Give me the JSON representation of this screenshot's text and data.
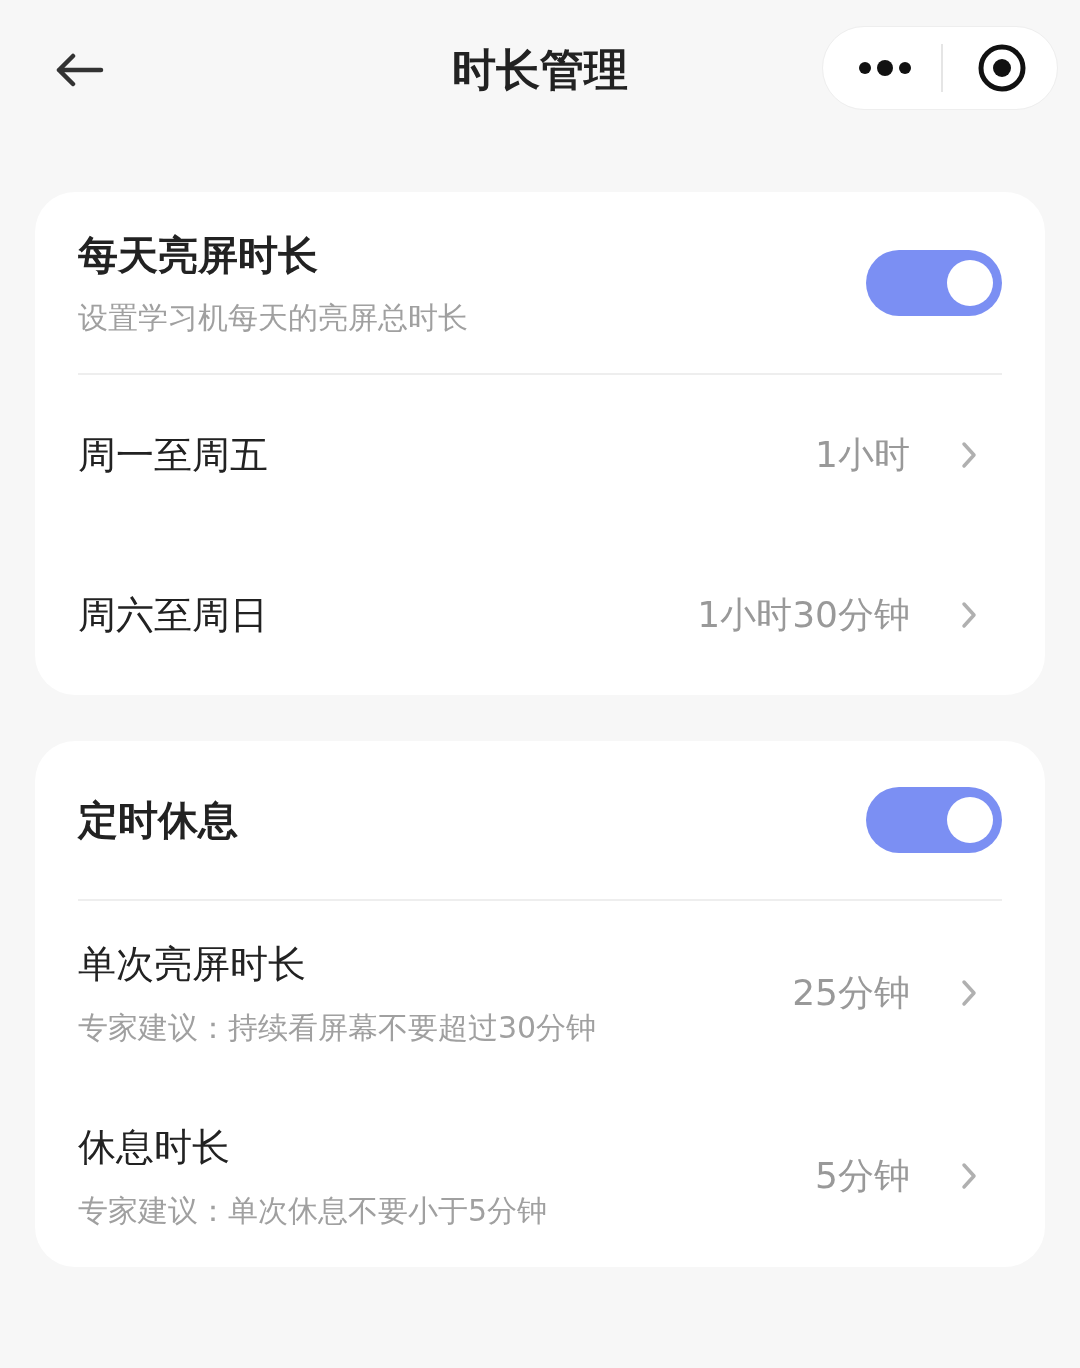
{
  "header": {
    "title": "时长管理"
  },
  "cards": [
    {
      "title": "每天亮屏时长",
      "subtitle": "设置学习机每天的亮屏总时长",
      "on": true,
      "rows": [
        {
          "label": "周一至周五",
          "value": "1小时"
        },
        {
          "label": "周六至周日",
          "value": "1小时30分钟"
        }
      ]
    },
    {
      "title": "定时休息",
      "on": true,
      "rows": [
        {
          "label": "单次亮屏时长",
          "hint": "专家建议：持续看屏幕不要超过30分钟",
          "value": "25分钟"
        },
        {
          "label": "休息时长",
          "hint": "专家建议：单次休息不要小于5分钟",
          "value": "5分钟"
        }
      ]
    }
  ]
}
